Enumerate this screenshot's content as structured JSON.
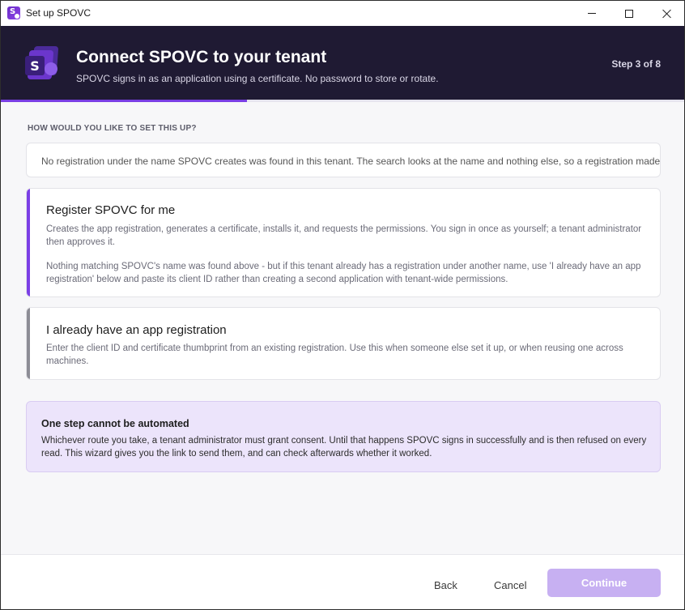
{
  "window": {
    "title": "Set up SPOVC"
  },
  "header": {
    "title": "Connect SPOVC to your tenant",
    "subtitle": "SPOVC signs in as an application using a certificate. No password to store or rotate.",
    "step": "Step 3 of 8",
    "progress_fraction": 0.375
  },
  "main": {
    "section_label": "HOW WOULD YOU LIKE TO SET THIS UP?",
    "search_result": "No registration under the name SPOVC creates was found in this tenant. The search looks at the name and nothing else, so a registration made here",
    "options": [
      {
        "title": "Register SPOVC for me",
        "description": "Creates the app registration, generates a certificate, installs it, and requests the permissions. You sign in once as yourself; a tenant administrator then approves it.",
        "note": "Nothing matching SPOVC's name was found above - but if this tenant already has a registration under another name, use 'I already have an app registration' below and paste its client ID rather than creating a second application with tenant-wide permissions.",
        "selected": true
      },
      {
        "title": "I already have an app registration",
        "description": "Enter the client ID and certificate thumbprint from an existing registration. Use this when someone else set it up, or when reusing one across machines.",
        "selected": false
      }
    ],
    "notice": {
      "title": "One step cannot be automated",
      "body": "Whichever route you take, a tenant administrator must grant consent. Until that happens SPOVC signs in successfully and is then refused on every read. This wizard gives you the link to send them, and can check afterwards whether it worked."
    }
  },
  "footer": {
    "back_label": "Back",
    "cancel_label": "Cancel",
    "continue_label": "Continue"
  },
  "colors": {
    "accent": "#7b3fe6",
    "header_bg": "#1f1a33",
    "continue_disabled": "#c7b0f2",
    "notice_bg": "#ece4fb"
  }
}
